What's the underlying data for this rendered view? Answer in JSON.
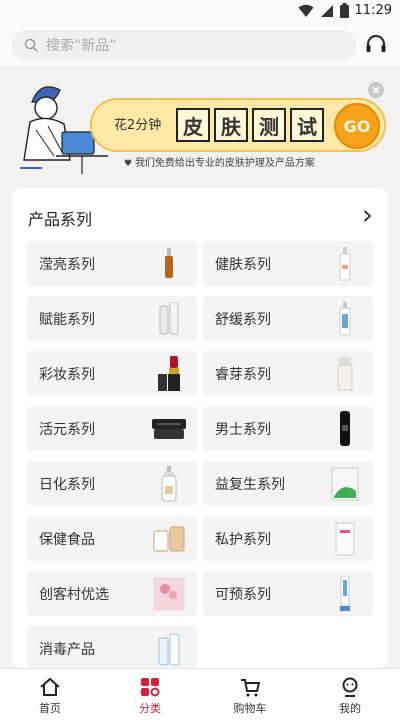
{
  "status": {
    "time": "11:29"
  },
  "search": {
    "placeholder": "搜索“新品”"
  },
  "banner": {
    "pre": "花2分钟",
    "words": [
      "皮",
      "肤",
      "测",
      "试"
    ],
    "go": "GO",
    "sub": "我们免费给出专业的皮肤护理及产品方案"
  },
  "section": {
    "title": "产品系列",
    "items": [
      {
        "label": "滢亮系列",
        "icon": "ampoule-bottle-icon"
      },
      {
        "label": "健肤系列",
        "icon": "slim-bottle-icon"
      },
      {
        "label": "赋能系列",
        "icon": "serum-bottles-icon"
      },
      {
        "label": "舒缓系列",
        "icon": "blue-label-bottle-icon"
      },
      {
        "label": "彩妆系列",
        "icon": "lipstick-icon"
      },
      {
        "label": "睿芽系列",
        "icon": "tube-bottle-icon"
      },
      {
        "label": "活元系列",
        "icon": "cream-jar-icon"
      },
      {
        "label": "男士系列",
        "icon": "black-bottle-icon"
      },
      {
        "label": "日化系列",
        "icon": "pump-bottle-icon"
      },
      {
        "label": "益复生系列",
        "icon": "green-box-icon"
      },
      {
        "label": "保健食品",
        "icon": "supplement-bottles-icon"
      },
      {
        "label": "私护系列",
        "icon": "care-box-icon"
      },
      {
        "label": "创客村优选",
        "icon": "product-box-icon"
      },
      {
        "label": "可预系列",
        "icon": "blue-tube-icon"
      },
      {
        "label": "消毒产品",
        "icon": "spray-bottles-icon"
      }
    ]
  },
  "tabs": [
    {
      "label": "首页",
      "icon": "home-icon",
      "active": false
    },
    {
      "label": "分类",
      "icon": "category-icon",
      "active": true
    },
    {
      "label": "购物车",
      "icon": "cart-icon",
      "active": false
    },
    {
      "label": "我的",
      "icon": "profile-icon",
      "active": false
    }
  ],
  "colors": {
    "accent": "#d81e3c",
    "banner_bg": "#ffe9a6",
    "go": "#f6a21a"
  }
}
